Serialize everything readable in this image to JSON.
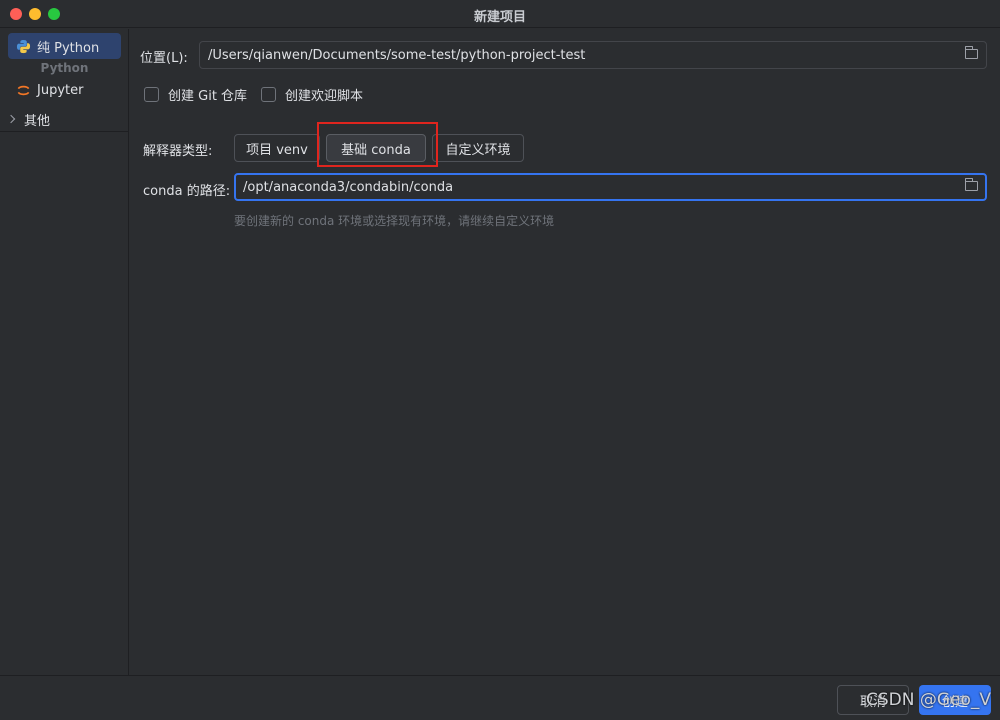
{
  "window": {
    "title": "新建项目"
  },
  "sidebar": {
    "items": [
      {
        "label": "纯 Python",
        "icon": "python-icon",
        "selected": true
      },
      {
        "label": "Jupyter",
        "icon": "jupyter-icon",
        "selected": false
      }
    ],
    "group_label": "Python",
    "other_label": "其他"
  },
  "location": {
    "label": "位置(L):",
    "value": "/Users/qianwen/Documents/some-test/python-project-test"
  },
  "options": {
    "git_label": "创建 Git 仓库",
    "welcome_label": "创建欢迎脚本"
  },
  "interpreter": {
    "label": "解释器类型:",
    "options": [
      "项目 venv",
      "基础 conda",
      "自定义环境"
    ],
    "selected": "基础 conda"
  },
  "conda": {
    "label": "conda 的路径:",
    "value": "/opt/anaconda3/condabin/conda",
    "hint": "要创建新的 conda 环境或选择现有环境，请继续自定义环境"
  },
  "footer": {
    "cancel_label": "取消",
    "create_label": "创建",
    "watermark": "CSDN @Geo_V"
  },
  "colors": {
    "accent": "#3574f0",
    "highlight": "#e0251e",
    "selected_row": "#2e436e"
  }
}
